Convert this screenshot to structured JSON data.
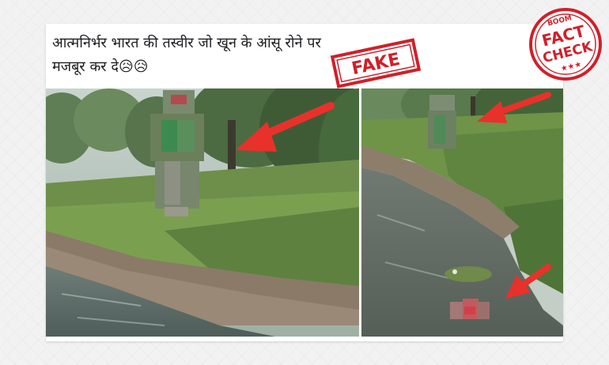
{
  "post": {
    "line1": "आत्मनिर्भर भारत की तस्वीर जो खून के आंसू रोने पर",
    "line2": "मजबूर कर दे😥😥"
  },
  "stamp": {
    "label": "FAKE",
    "color": "#d0202a"
  },
  "badge": {
    "top_text": "BOOM",
    "line1": "FACT",
    "line2": "CHECK",
    "stars": "★★★",
    "color": "#d0202a"
  },
  "annotation": {
    "arrow_color": "#e8312a"
  }
}
